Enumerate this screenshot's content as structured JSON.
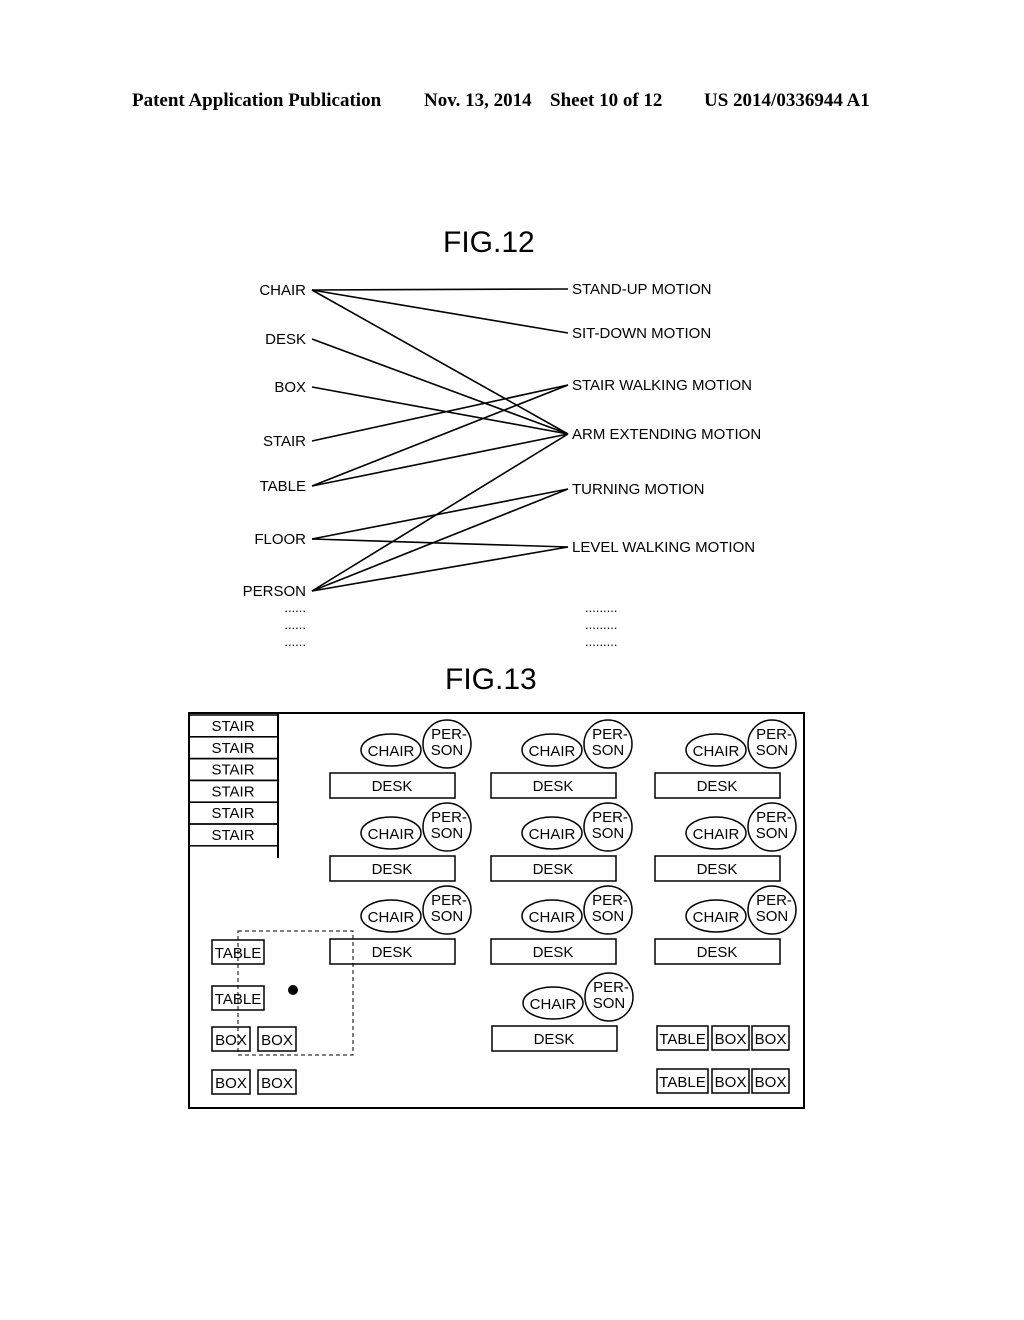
{
  "header": {
    "publication": "Patent Application Publication",
    "date": "Nov. 13, 2014",
    "sheet": "Sheet 10 of 12",
    "number": "US 2014/0336944 A1"
  },
  "fig12": {
    "title": "FIG.12",
    "objects": [
      "CHAIR",
      "DESK",
      "BOX",
      "STAIR",
      "TABLE",
      "FLOOR",
      "PERSON"
    ],
    "motions": [
      "STAND-UP MOTION",
      "SIT-DOWN MOTION",
      "STAIR WALKING MOTION",
      "ARM EXTENDING MOTION",
      "TURNING MOTION",
      "LEVEL WALKING MOTION"
    ],
    "links": [
      [
        "CHAIR",
        "STAND-UP MOTION"
      ],
      [
        "CHAIR",
        "SIT-DOWN MOTION"
      ],
      [
        "CHAIR",
        "ARM EXTENDING MOTION"
      ],
      [
        "DESK",
        "ARM EXTENDING MOTION"
      ],
      [
        "BOX",
        "ARM EXTENDING MOTION"
      ],
      [
        "STAIR",
        "STAIR WALKING MOTION"
      ],
      [
        "TABLE",
        "STAIR WALKING MOTION"
      ],
      [
        "TABLE",
        "ARM EXTENDING MOTION"
      ],
      [
        "FLOOR",
        "TURNING MOTION"
      ],
      [
        "FLOOR",
        "LEVEL WALKING MOTION"
      ],
      [
        "PERSON",
        "ARM EXTENDING MOTION"
      ],
      [
        "PERSON",
        "TURNING MOTION"
      ],
      [
        "PERSON",
        "LEVEL WALKING MOTION"
      ]
    ],
    "left_ellipsis": [
      "......",
      "......",
      "......"
    ],
    "right_ellipsis": [
      ".........",
      ".........",
      "........."
    ]
  },
  "fig13": {
    "title": "FIG.13",
    "stairs": [
      "STAIR",
      "STAIR",
      "STAIR",
      "STAIR",
      "STAIR",
      "STAIR"
    ],
    "chair_label": "CHAIR",
    "person_label_1": "PER-",
    "person_label_2": "SON",
    "desk_label": "DESK",
    "table_label": "TABLE",
    "box_label": "BOX"
  }
}
